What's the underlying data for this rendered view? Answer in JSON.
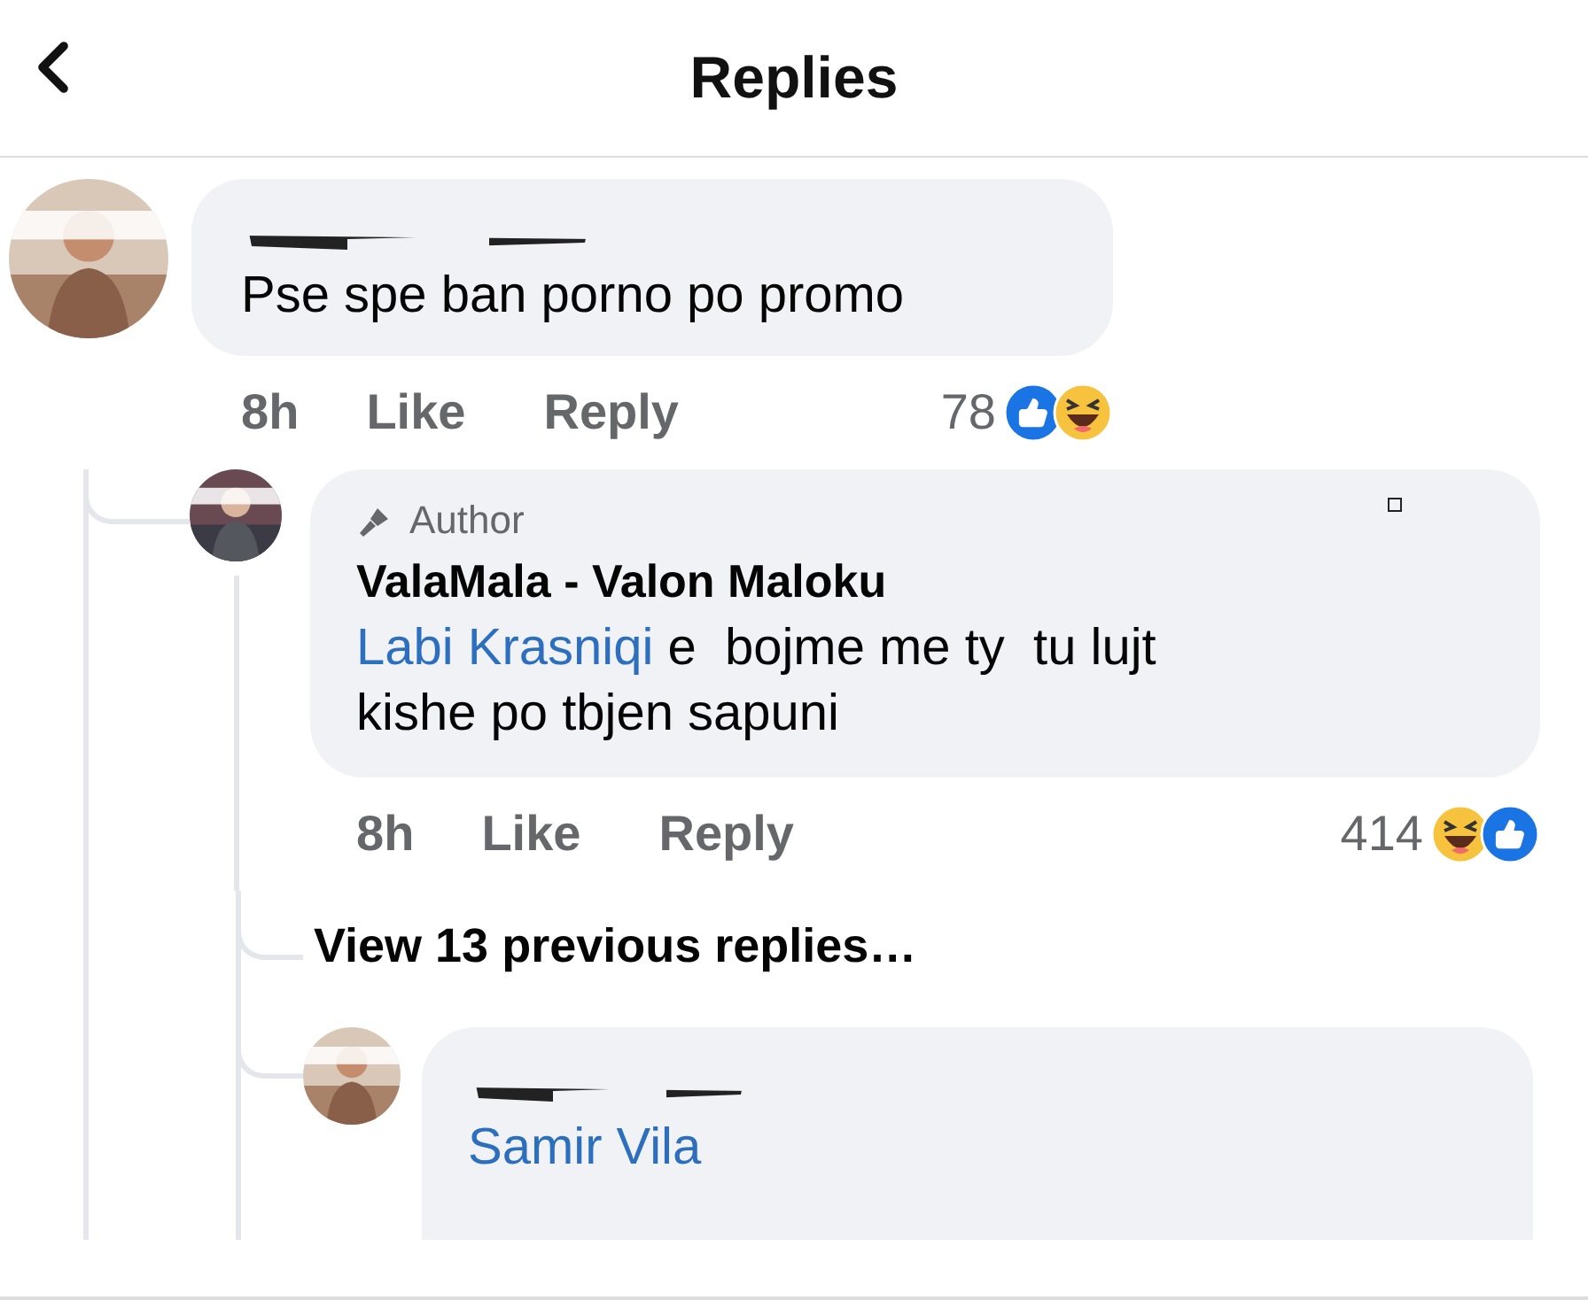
{
  "header": {
    "title": "Replies"
  },
  "comment": {
    "text": "Pse spe ban porno po promo",
    "time": "8h",
    "actions": [
      "Like",
      "Reply"
    ],
    "reaction_count": "78",
    "reactions": [
      {
        "kind": "like"
      },
      {
        "kind": "haha"
      }
    ]
  },
  "reply": {
    "badge": "Author",
    "author": "ValaMala - Valon Maloku",
    "mention": "Labi Krasniqi",
    "text": " e  bojme me ty  tu lujt kishe po tbjen sapuni",
    "time": "8h",
    "actions": [
      "Like",
      "Reply"
    ],
    "reaction_count": "414",
    "reactions": [
      {
        "kind": "haha"
      },
      {
        "kind": "like"
      }
    ]
  },
  "view_more": "View 13 previous replies…",
  "last_reply": {
    "mention": "Samir Vila"
  }
}
